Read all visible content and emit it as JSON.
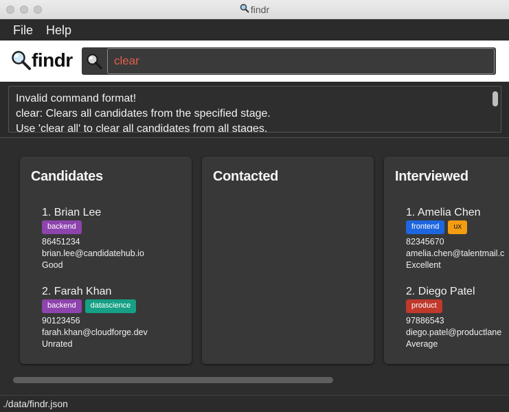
{
  "window": {
    "title": "findr"
  },
  "menu": {
    "file": "File",
    "help": "Help"
  },
  "logo": {
    "text": "findr"
  },
  "search": {
    "value": "clear"
  },
  "result": {
    "lines": [
      "Invalid command format!",
      "clear: Clears all candidates from the specified stage.",
      "Use 'clear all' to clear all candidates from all stages."
    ]
  },
  "stages": [
    {
      "title": "Candidates",
      "candidates": [
        {
          "name": "1. Brian Lee",
          "tags": [
            {
              "label": "backend",
              "color": "#8e44ad"
            }
          ],
          "phone": "86451234",
          "email": "brian.lee@candidatehub.io",
          "rating": "Good"
        },
        {
          "name": "2. Farah Khan",
          "tags": [
            {
              "label": "backend",
              "color": "#8e44ad"
            },
            {
              "label": "datascience",
              "color": "#16a085"
            }
          ],
          "phone": "90123456",
          "email": "farah.khan@cloudforge.dev",
          "rating": "Unrated"
        }
      ]
    },
    {
      "title": "Contacted",
      "candidates": []
    },
    {
      "title": "Interviewed",
      "candidates": [
        {
          "name": "1. Amelia Chen",
          "tags": [
            {
              "label": "frontend",
              "color": "#1e66e0"
            },
            {
              "label": "ux",
              "color": "#f39c12"
            }
          ],
          "phone": "82345670",
          "email": "amelia.chen@talentmail.c",
          "rating": "Excellent"
        },
        {
          "name": "2. Diego Patel",
          "tags": [
            {
              "label": "product",
              "color": "#c0392b"
            }
          ],
          "phone": "97886543",
          "email": "diego.patel@productlane",
          "rating": "Average"
        }
      ]
    }
  ],
  "status": {
    "path": "./data/findr.json"
  }
}
